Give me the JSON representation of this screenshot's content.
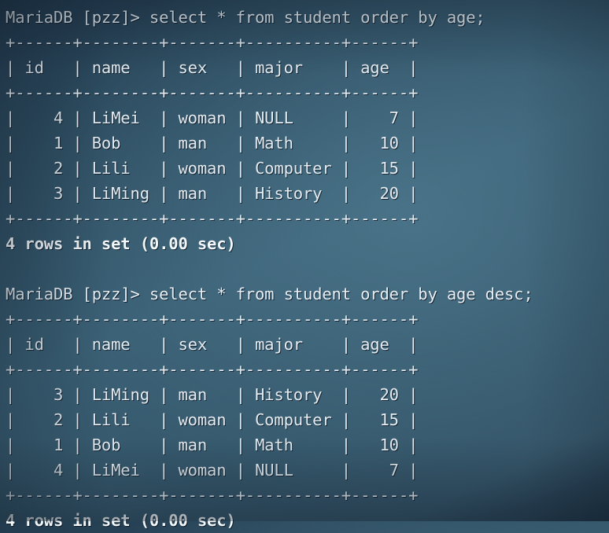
{
  "terminal": {
    "prompt": "MariaDB [pzz]> ",
    "background_color": "#3a5c70",
    "text_color": "#dfe8ee",
    "sessions": [
      {
        "command_line": "MariaDB [pzz]> select * from student order by age;",
        "command": "select * from student order by age;",
        "rule_top": "+------+--------+-------+----------+------+",
        "header_line": "| id   | name   | sex   | major    | age  |",
        "rule_mid": "+------+--------+-------+----------+------+",
        "data_lines": [
          "|    4 | LiMei  | woman | NULL     |    7 |",
          "|    1 | Bob    | man   | Math     |   10 |",
          "|    2 | Lili   | woman | Computer |   15 |",
          "|    3 | LiMing | man   | History  |   20 |"
        ],
        "rule_bottom": "+------+--------+-------+----------+------+",
        "status": "4 rows in set (0.00 sec)",
        "columns": [
          "id",
          "name",
          "sex",
          "major",
          "age"
        ],
        "rows": [
          {
            "id": "4",
            "name": "LiMei",
            "sex": "woman",
            "major": "NULL",
            "age": "7"
          },
          {
            "id": "1",
            "name": "Bob",
            "sex": "man",
            "major": "Math",
            "age": "10"
          },
          {
            "id": "2",
            "name": "Lili",
            "sex": "woman",
            "major": "Computer",
            "age": "15"
          },
          {
            "id": "3",
            "name": "LiMing",
            "sex": "man",
            "major": "History",
            "age": "20"
          }
        ],
        "row_count": "4",
        "elapsed": "0.00 sec"
      },
      {
        "command_line": "MariaDB [pzz]> select * from student order by age desc;",
        "command": "select * from student order by age desc;",
        "rule_top": "+------+--------+-------+----------+------+",
        "header_line": "| id   | name   | sex   | major    | age  |",
        "rule_mid": "+------+--------+-------+----------+------+",
        "data_lines": [
          "|    3 | LiMing | man   | History  |   20 |",
          "|    2 | Lili   | woman | Computer |   15 |",
          "|    1 | Bob    | man   | Math     |   10 |",
          "|    4 | LiMei  | woman | NULL     |    7 |"
        ],
        "rule_bottom": "+------+--------+-------+----------+------+",
        "status": "4 rows in set (0.00 sec)",
        "columns": [
          "id",
          "name",
          "sex",
          "major",
          "age"
        ],
        "rows": [
          {
            "id": "3",
            "name": "LiMing",
            "sex": "man",
            "major": "History",
            "age": "20"
          },
          {
            "id": "2",
            "name": "Lili",
            "sex": "woman",
            "major": "Computer",
            "age": "15"
          },
          {
            "id": "1",
            "name": "Bob",
            "sex": "man",
            "major": "Math",
            "age": "10"
          },
          {
            "id": "4",
            "name": "LiMei",
            "sex": "woman",
            "major": "NULL",
            "age": "7"
          }
        ],
        "row_count": "4",
        "elapsed": "0.00 sec"
      }
    ],
    "blank_separator": " "
  }
}
